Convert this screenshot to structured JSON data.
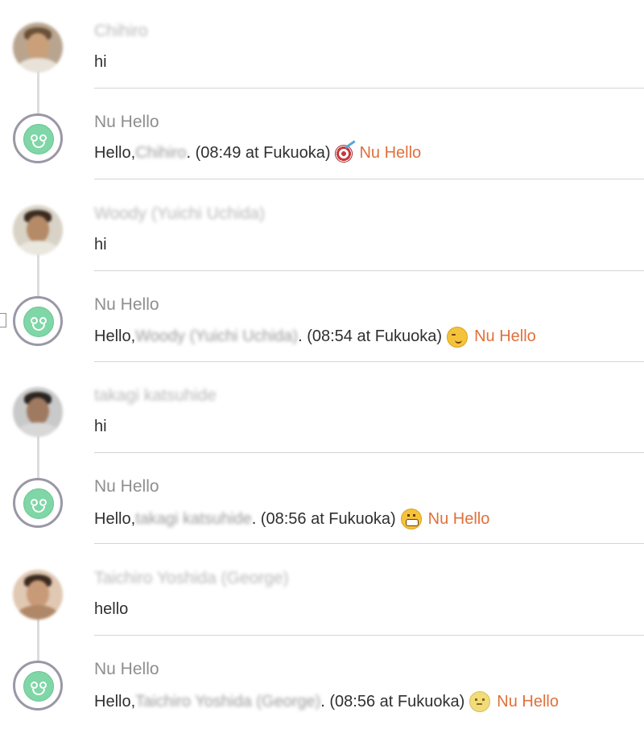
{
  "messages": [
    {
      "sender": "Chihiro",
      "text": "hi",
      "type": "user",
      "palette": {
        "skin": "#c9a07a",
        "hair": "#6b5038",
        "body": "#e8e2d8",
        "bg": "#b9a58f"
      }
    },
    {
      "sender": "Nu Hello",
      "type": "bot",
      "prefix": "Hello, ",
      "name_ref": "Chihiro",
      "suffix": ". (08:49 at Fukuoka)",
      "emoji": "direct-hit",
      "link": "Nu Hello"
    },
    {
      "sender": "Woody (Yuichi Uchida)",
      "text": "hi",
      "type": "user",
      "palette": {
        "skin": "#b58a66",
        "hair": "#3a2a20",
        "body": "#e9e7de",
        "bg": "#d8d3c6"
      }
    },
    {
      "sender": "Nu Hello",
      "type": "bot",
      "prefix": "Hello, ",
      "name_ref": "Woody (Yuichi Uchida)",
      "suffix": ". (08:54 at Fukuoka)",
      "emoji": "smirk",
      "link": "Nu Hello"
    },
    {
      "sender": "takagi katsuhide",
      "text": "hi",
      "type": "user",
      "palette": {
        "skin": "#a07a60",
        "hair": "#2a2320",
        "body": "#d8d8d8",
        "bg": "#c9c9c9"
      }
    },
    {
      "sender": "Nu Hello",
      "type": "bot",
      "prefix": "Hello, ",
      "name_ref": "takagi katsuhide",
      "suffix": ". (08:56 at Fukuoka)",
      "emoji": "grimace",
      "link": "Nu Hello"
    },
    {
      "sender": "Taichiro Yoshida (George)",
      "text": "hello",
      "type": "user",
      "palette": {
        "skin": "#c99a78",
        "hair": "#3b2a1e",
        "body": "#b08868",
        "bg": "#e0c8b2"
      }
    },
    {
      "sender": "Nu Hello",
      "type": "bot",
      "prefix": "Hello, ",
      "name_ref": "Taichiro Yoshida (George)",
      "suffix": ". (08:56 at Fukuoka)",
      "emoji": "moon",
      "link": "Nu Hello"
    }
  ],
  "colors": {
    "link": "#e0703c",
    "bot_face": "#7fd6a6",
    "bot_ring": "#9a97a6",
    "divider": "#d4d4d4"
  }
}
